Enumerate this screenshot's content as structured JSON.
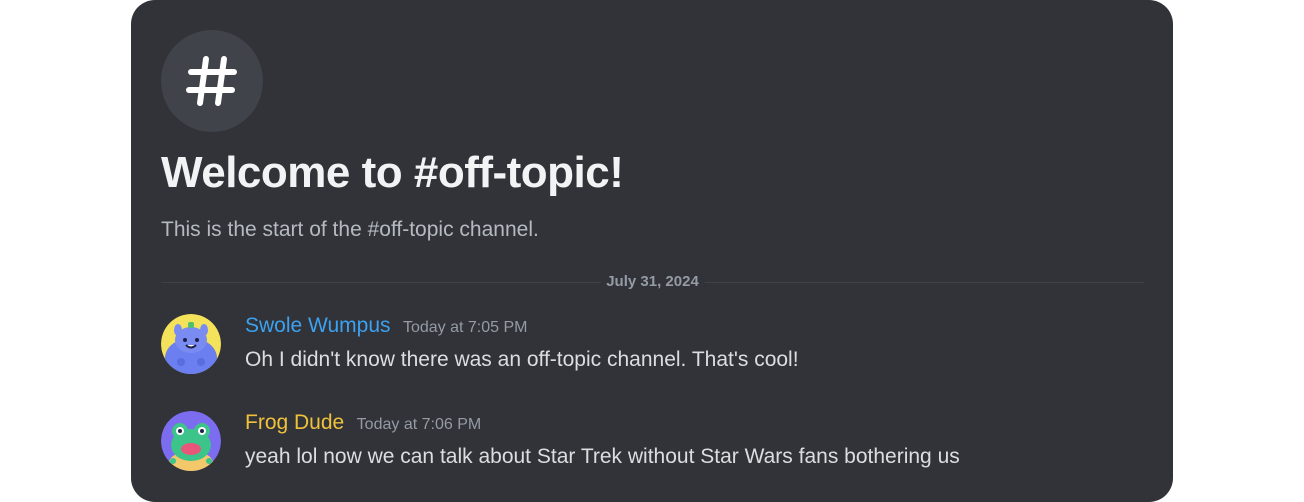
{
  "channel": {
    "icon": "hash-icon",
    "welcome_title": "Welcome to #off-topic!",
    "welcome_subtitle": "This is the start of the #off-topic channel."
  },
  "date_divider": "July 31, 2024",
  "messages": [
    {
      "author": "Swole Wumpus",
      "author_color": "#3ba1f0",
      "timestamp": "Today at 7:05 PM",
      "text": "Oh I didn't know there was an off-topic channel. That's cool!",
      "avatar": "wumpus-avatar"
    },
    {
      "author": "Frog Dude",
      "author_color": "#f0c23b",
      "timestamp": "Today at 7:06 PM",
      "text": "yeah lol now we can talk about Star Trek without Star Wars fans bothering us",
      "avatar": "frog-avatar"
    }
  ],
  "colors": {
    "background": "#313338",
    "title": "#f2f3f5",
    "subtitle": "#b5bac1",
    "muted": "#949ba4",
    "message_text": "#dbdee1"
  }
}
